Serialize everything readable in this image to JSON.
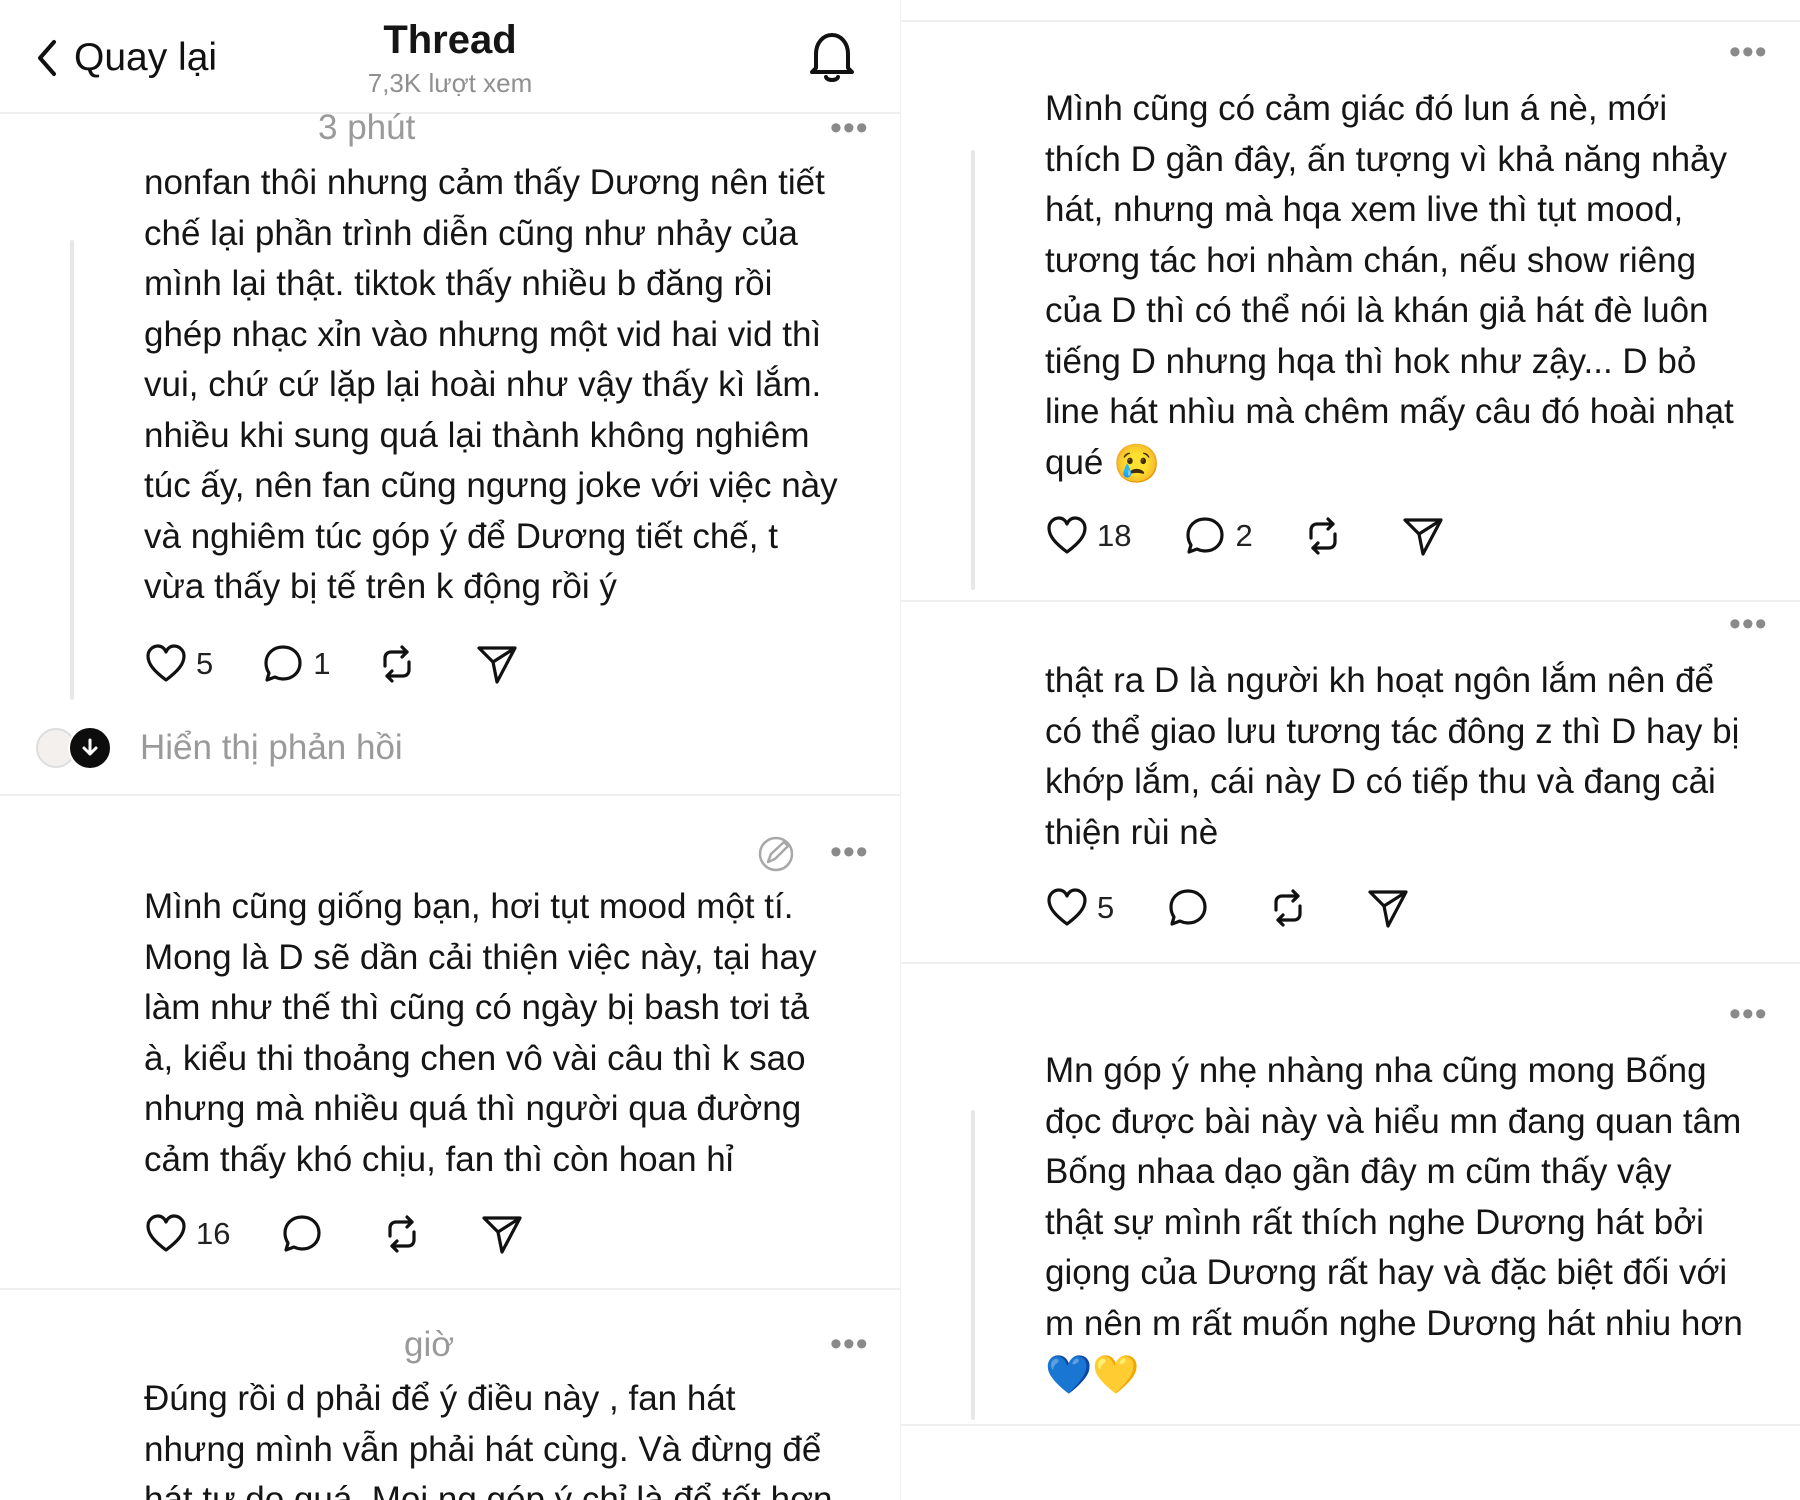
{
  "header": {
    "back_label": "Quay lại",
    "title": "Thread",
    "views": "7,3K lượt xem"
  },
  "left_posts": [
    {
      "time": "3 phút",
      "text": "nonfan thôi nhưng cảm thấy Dương nên tiết\nchế lại phần trình diễn cũng như nhảy của\nmình lại thật. tiktok thấy nhiều b đăng rồi\nghép nhạc xỉn vào nhưng một vid hai vid thì\nvui, chứ cứ lặp lại hoài như vậy thấy kì lắm.\nnhiều khi sung quá lại thành không nghiêm\ntúc ấy, nên fan cũng ngưng joke với việc này\nvà nghiêm túc góp ý để Dương tiết chế, t\nvừa thấy bị tế trên k động rồi ý",
      "likes": "5",
      "replies": "1"
    },
    {
      "text": "Mình cũng giống bạn, hơi tụt mood một tí.\nMong là D sẽ dần cải thiện việc này, tại hay\nlàm như thế thì cũng có ngày bị bash tơi tả\nà, kiểu thi thoảng chen vô vài câu thì k sao\nnhưng mà nhiều quá thì người qua đường\ncảm thấy khó chịu, fan thì còn hoan hỉ",
      "likes": "16",
      "replies": ""
    },
    {
      "time": "giờ",
      "text": "Đúng rồi d phải để ý điều này , fan hát\nnhưng mình vẫn phải hát cùng. Và đừng để\nhát tự do quá. Mọi ng góp ý chỉ là để tốt hơn"
    }
  ],
  "show_replies_label": "Hiển thị phản hồi",
  "right_posts": [
    {
      "text": "Mình cũng có cảm giác đó lun á nè, mới\nthích D gần đây, ấn tượng vì khả năng nhảy\nhát, nhưng mà hqa xem live thì tụt mood,\ntương tác hơi nhàm chán, nếu show riêng\ncủa D thì có thể nói là khán giả hát đè luôn\ntiếng D nhưng hqa thì hok như zậy... D bỏ\nline hát nhìu mà chêm mấy câu đó hoài nhạt\nqué",
      "emoji": "😢",
      "likes": "18",
      "replies": "2"
    },
    {
      "text": "thật ra D là người kh hoạt ngôn lắm nên để\ncó thể giao lưu tương tác đông z thì D hay bị\nkhớp lắm, cái này D có tiếp thu và đang cải\nthiện rùi nè",
      "likes": "5",
      "replies": ""
    },
    {
      "text": "Mn góp ý nhẹ nhàng nha cũng mong Bống\nđọc được bài này và hiểu mn đang quan tâm\nBống nhaa dạo gần đây m cũm thấy vậy\nthật sự mình rất thích nghe Dương hát bởi\ngiọng của Dương rất hay và đặc biệt đối với\nm nên m rất muốn nghe Dương hát nhiu hơn",
      "emoji": "💙💛"
    }
  ],
  "icons": {
    "back": "chevron-left-icon",
    "bell": "bell-icon",
    "like": "heart-icon",
    "reply": "comment-icon",
    "repost": "repost-icon",
    "share": "send-icon",
    "more": "more-icon",
    "edit": "edit-icon",
    "down": "arrow-down-icon"
  },
  "colors": {
    "text": "#151515",
    "muted": "#9a9a9a",
    "divider": "#efefef",
    "thread_line": "#e7e7e7"
  }
}
